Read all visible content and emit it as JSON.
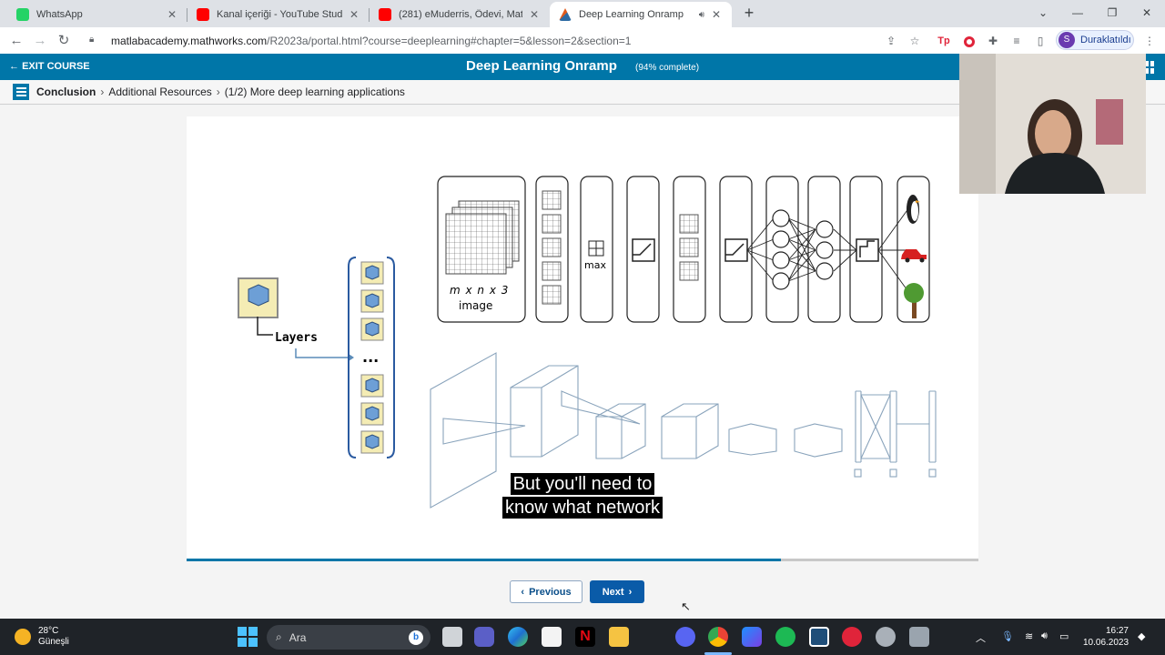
{
  "browser": {
    "tabs": [
      {
        "title": "WhatsApp",
        "favicon": "whatsapp-icon",
        "active": false
      },
      {
        "title": "Kanal içeriği - YouTube Studio",
        "favicon": "youtube-icon",
        "active": false
      },
      {
        "title": "(281) eMuderris, Ödevi, Matlab d",
        "favicon": "youtube-icon",
        "active": false
      },
      {
        "title": "Deep Learning Onramp",
        "favicon": "matlab-icon",
        "active": true
      }
    ],
    "new_tab_label": "+",
    "url_host": "matlabacademy.mathworks.com",
    "url_path": "/R2023a/portal.html?course=deeplearning#chapter=5&lesson=2&section=1",
    "profile_initial": "S",
    "profile_label": "Duraklatıldı"
  },
  "course": {
    "exit_label": "EXIT COURSE",
    "title": "Deep Learning Onramp",
    "progress_text": "(94% complete)",
    "breadcrumb": {
      "section": "Conclusion",
      "lesson": "Additional Resources",
      "page": "(1/2) More deep learning applications"
    },
    "slide": {
      "layers_label": "Layers",
      "image_dims": "m x n x 3",
      "image_label": "image",
      "max_label": "max",
      "ellipsis": "..."
    },
    "slide_progress": 0.75,
    "caption_lines": [
      "But you'll need to",
      "know what network"
    ],
    "previous_label": "Previous",
    "next_label": "Next"
  },
  "taskbar": {
    "temperature": "28°C",
    "weather": "Güneşli",
    "search_placeholder": "Ara",
    "time": "16:27",
    "date": "10.06.2023"
  },
  "colors": {
    "brand_blue": "#0076a8",
    "next_button": "#0a5ba8",
    "taskbar": "#1f2328"
  }
}
